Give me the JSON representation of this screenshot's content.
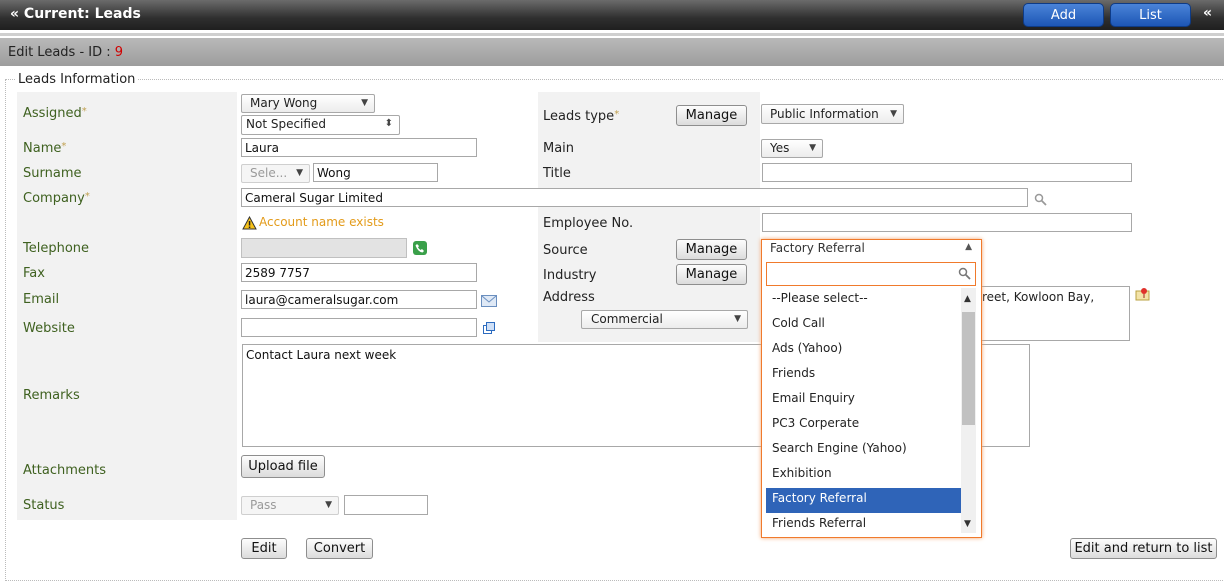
{
  "header": {
    "title": "« Current: Leads",
    "add_label": "Add",
    "list_label": "List",
    "collapse_glyph": "«"
  },
  "subheader": {
    "prefix": "Edit Leads - ID : ",
    "id": "9"
  },
  "section": {
    "legend": "Leads Information"
  },
  "labels": {
    "assigned": "Assigned",
    "name": "Name",
    "surname": "Surname",
    "company": "Company",
    "telephone": "Telephone",
    "fax": "Fax",
    "email": "Email",
    "website": "Website",
    "remarks": "Remarks",
    "attachments": "Attachments",
    "status": "Status",
    "leads_type": "Leads type",
    "main": "Main",
    "title": "Title",
    "employee_no": "Employee No.",
    "source": "Source",
    "industry": "Industry",
    "address": "Address",
    "required_mark": "*"
  },
  "fields": {
    "assigned_user": "Mary Wong",
    "assigned_second": "Not Specified",
    "name": "Laura",
    "salutation": "Sele...",
    "surname": "Wong",
    "company": "Cameral Sugar Limited",
    "company_warning": "Account name exists",
    "telephone": "",
    "fax": "2589 7757",
    "email": "laura@cameralsugar.com",
    "website": "",
    "remarks": "Contact Laura next week",
    "status": "Pass",
    "status_note": "",
    "leads_type": "Public Information",
    "main": "Yes",
    "title": "",
    "employee_no": "",
    "source": "Factory Referral",
    "address_type": "Commercial",
    "address_visible": "reet, Kowloon Bay,"
  },
  "buttons": {
    "manage": "Manage",
    "upload": "Upload file",
    "edit": "Edit",
    "convert": "Convert",
    "edit_return": "Edit and return to list"
  },
  "source_dropdown": {
    "selected": "Factory Referral",
    "search_value": "",
    "options": [
      "--Please select--",
      "Cold Call",
      "Ads (Yahoo)",
      "Friends",
      "Email Enquiry",
      "PC3 Corperate",
      "Search Engine (Yahoo)",
      "Exhibition",
      "Factory Referral",
      "Friends Referral"
    ]
  },
  "icons": {
    "search": "search-icon",
    "phone": "phone-icon",
    "mail": "mail-icon",
    "external_link": "external-link-icon",
    "map_pin": "map-pin-icon",
    "warning": "warning-icon"
  },
  "colors": {
    "accent_blue": "#2f64b8",
    "label_green": "#3f6120",
    "warning_orange": "#e39b1a",
    "dropdown_border": "#f07a2c",
    "id_red": "#d00000"
  }
}
